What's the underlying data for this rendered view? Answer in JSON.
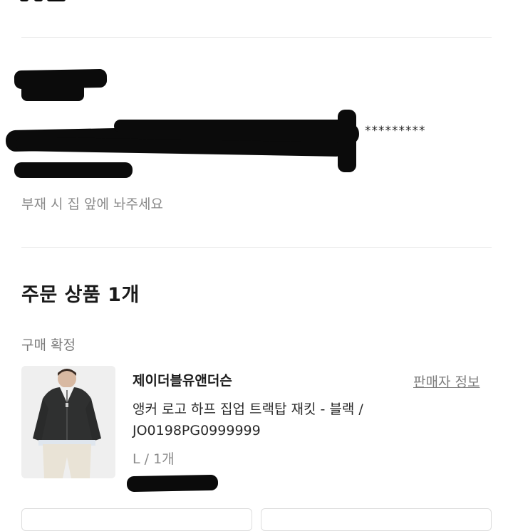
{
  "delivery": {
    "masked_phone": "*********",
    "memo": "부재 시 집 앞에 놔주세요"
  },
  "order": {
    "section_title": "주문 상품 1개",
    "status": "구매 확정",
    "item": {
      "brand": "제이더블유앤더슨",
      "seller_link": "판매자 정보",
      "name_line1": "앵커 로고 하프 집업 트랙탑 재킷 - 블랙 /",
      "name_line2": "JO0198PG0999999",
      "option": "L / 1개",
      "thumbnail_icon": "product-photo-jacket"
    }
  },
  "colors": {
    "muted_text": "#8a8a8a",
    "divider": "#ececec",
    "redaction": "#0b0b0b"
  }
}
